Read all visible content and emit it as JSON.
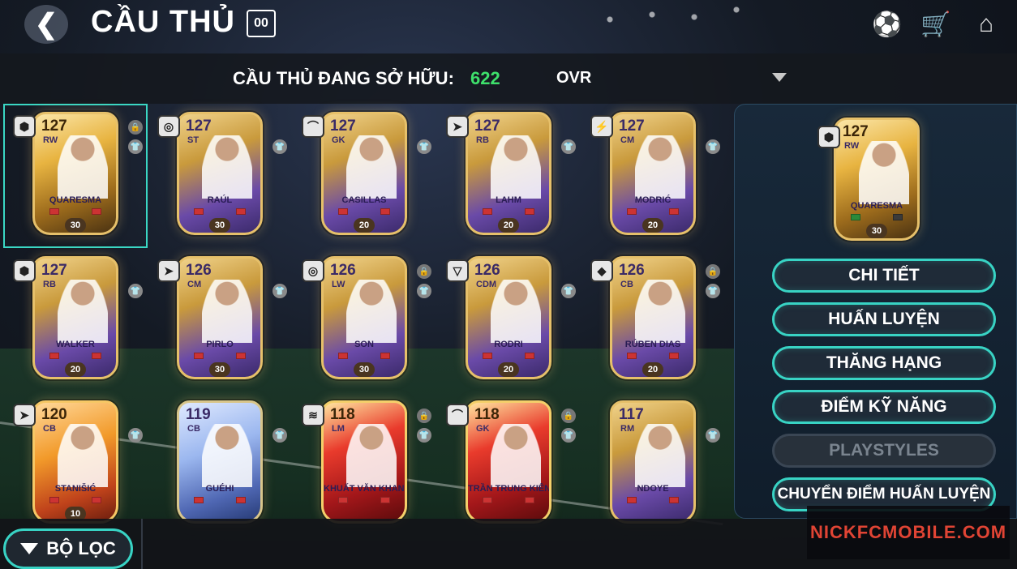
{
  "header": {
    "title": "CẦU THỦ",
    "title_badge": "00",
    "icons": [
      "soccer-ball-icon",
      "cart-icon",
      "home-icon"
    ]
  },
  "owned": {
    "label": "CẦU THỦ ĐANG SỞ HỮU:",
    "count": "622"
  },
  "sort": {
    "value": "OVR"
  },
  "cards": [
    {
      "ovr": "127",
      "pos": "RW",
      "name": "QUARESMA",
      "level": "30",
      "badge": "⬢",
      "style": "gold",
      "selected": true,
      "locked": true
    },
    {
      "ovr": "127",
      "pos": "ST",
      "name": "RAÚL",
      "level": "30",
      "badge": "◎",
      "style": "purple",
      "selected": false,
      "locked": false
    },
    {
      "ovr": "127",
      "pos": "GK",
      "name": "CASILLAS",
      "level": "20",
      "badge": "⌒",
      "style": "purple",
      "selected": false,
      "locked": false
    },
    {
      "ovr": "127",
      "pos": "RB",
      "name": "LAHM",
      "level": "20",
      "badge": "➤",
      "style": "purple",
      "selected": false,
      "locked": false
    },
    {
      "ovr": "127",
      "pos": "CM",
      "name": "MODRIĆ",
      "level": "20",
      "badge": "⚡",
      "style": "purple",
      "selected": false,
      "locked": false
    },
    {
      "ovr": "127",
      "pos": "RB",
      "name": "WALKER",
      "level": "20",
      "badge": "⬢",
      "style": "purple",
      "selected": false,
      "locked": false
    },
    {
      "ovr": "126",
      "pos": "CM",
      "name": "PIRLO",
      "level": "30",
      "badge": "➤",
      "style": "purple",
      "selected": false,
      "locked": false
    },
    {
      "ovr": "126",
      "pos": "LW",
      "name": "SON",
      "level": "30",
      "badge": "◎",
      "style": "purple",
      "selected": false,
      "locked": true
    },
    {
      "ovr": "126",
      "pos": "CDM",
      "name": "RODRI",
      "level": "20",
      "badge": "▽",
      "style": "purple",
      "selected": false,
      "locked": false
    },
    {
      "ovr": "126",
      "pos": "CB",
      "name": "RÚBEN DIAS",
      "level": "20",
      "badge": "◆",
      "style": "purple",
      "selected": false,
      "locked": true
    },
    {
      "ovr": "120",
      "pos": "CB",
      "name": "STANIŠIĆ",
      "level": "10",
      "badge": "➤",
      "style": "orange",
      "selected": false,
      "locked": false
    },
    {
      "ovr": "119",
      "pos": "CB",
      "name": "GUÉHI",
      "level": "",
      "badge": "",
      "style": "blue",
      "selected": false,
      "locked": false
    },
    {
      "ovr": "118",
      "pos": "LM",
      "name": "KHUẤT VĂN KHANG",
      "level": "",
      "badge": "≋",
      "style": "red",
      "selected": false,
      "locked": true
    },
    {
      "ovr": "118",
      "pos": "GK",
      "name": "TRẦN TRUNG KIÊN",
      "level": "",
      "badge": "⌒",
      "style": "red",
      "selected": false,
      "locked": true
    },
    {
      "ovr": "117",
      "pos": "RM",
      "name": "NDOYE",
      "level": "",
      "badge": "",
      "style": "purple",
      "selected": false,
      "locked": false
    }
  ],
  "selected_card": {
    "ovr": "127",
    "pos": "RW",
    "name": "QUARESMA",
    "level": "30",
    "badge": "⬢"
  },
  "actions": [
    {
      "label": "CHI TIẾT",
      "enabled": true
    },
    {
      "label": "HUẤN LUYỆN",
      "enabled": true
    },
    {
      "label": "THĂNG HẠNG",
      "enabled": true
    },
    {
      "label": "ĐIỂM KỸ NĂNG",
      "enabled": true
    },
    {
      "label": "PLAYSTYLES",
      "enabled": false
    },
    {
      "label": "CHUYỂN ĐIỂM HUẤN LUYỆN",
      "enabled": true
    }
  ],
  "filter": {
    "label": "BỘ LỌC"
  },
  "watermark": "NICKFCMOBILE.COM",
  "colors": {
    "accent": "#38d3c4",
    "owned_count": "#3ee06b",
    "watermark": "#e04434"
  }
}
